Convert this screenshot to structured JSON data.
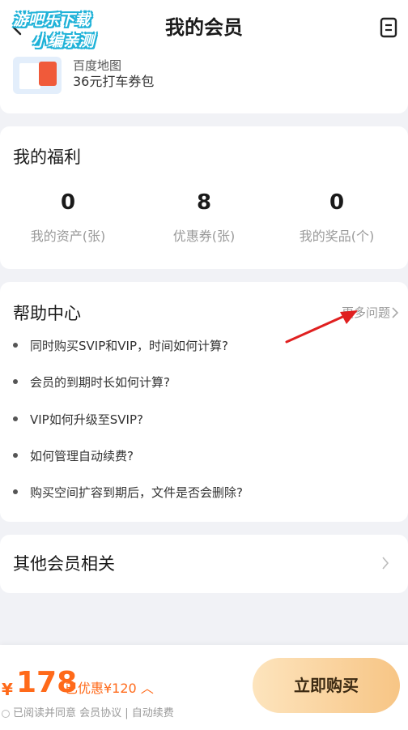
{
  "header": {
    "title": "我的会员",
    "watermark_line1": "游吧乐下载",
    "watermark_line2": "小编亲测"
  },
  "coupon": {
    "name": "百度地图",
    "desc": "36元打车券包"
  },
  "welfare": {
    "title": "我的福利",
    "stats": [
      {
        "value": "0",
        "label": "我的资产(张)"
      },
      {
        "value": "8",
        "label": "优惠券(张)"
      },
      {
        "value": "0",
        "label": "我的奖品(个)"
      }
    ]
  },
  "help": {
    "title": "帮助中心",
    "more": "更多问题",
    "items": [
      "同时购买SVIP和VIP，时间如何计算?",
      "会员的到期时长如何计算?",
      "VIP如何升级至SVIP?",
      "如何管理自动续费?",
      "购买空间扩容到期后，文件是否会删除?"
    ]
  },
  "other": {
    "title": "其他会员相关"
  },
  "bottom": {
    "currency": "¥",
    "price": "178",
    "discount": "已优惠¥120",
    "agreement": "已阅读并同意 会员协议 | 自动续费",
    "buy_label": "立即购买"
  },
  "colors": {
    "accent": "#ff6a1a",
    "button_gradient_start": "#fde4bd",
    "button_gradient_end": "#f7c585",
    "annotation_arrow": "#e02020"
  }
}
